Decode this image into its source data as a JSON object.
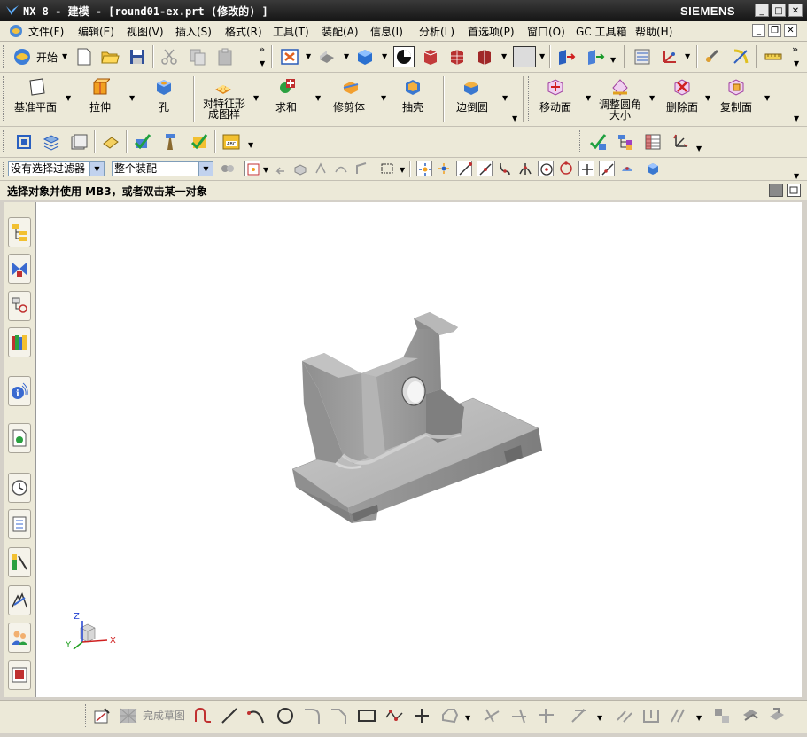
{
  "title_bar": {
    "app_icon": "nx-logo-icon",
    "title": "NX 8 - 建模 - [round01-ex.prt  (修改的) ]",
    "brand": "SIEMENS",
    "buttons": [
      "minimize-icon",
      "maximize-icon",
      "close-icon"
    ]
  },
  "menu_bar": {
    "items": [
      "文件(F)",
      "编辑(E)",
      "视图(V)",
      "插入(S)",
      "格式(R)",
      "工具(T)",
      "装配(A)",
      "信息(I)",
      "分析(L)",
      "首选项(P)",
      "窗口(O)",
      "GC 工具箱",
      "帮助(H)"
    ]
  },
  "standard_toolbar": {
    "start_label": "开始"
  },
  "feature_toolbar": {
    "buttons": [
      "基准平面",
      "拉伸",
      "孔",
      "对特征形成图样",
      "求和",
      "修剪体",
      "抽壳",
      "边倒圆"
    ],
    "sync_buttons": [
      "移动面",
      "调整圆角大小",
      "删除面",
      "复制面"
    ]
  },
  "selection_bar": {
    "type_filter": "没有选择过滤器",
    "scope_filter": "整个装配"
  },
  "status_line": {
    "text": "选择对象并使用 MB3，或者双击某一对象"
  },
  "coordinate_triad": {
    "x": "X",
    "y": "Y",
    "z": "Z"
  },
  "sketch_toolbar": {
    "finish_sketch_label": "完成草图"
  },
  "colors": {
    "title_bg": "#1e1e1e",
    "toolbar_bg": "#ece9d8",
    "viewport_bg": "#ffffff",
    "model_grey": "#9a9a9a"
  }
}
